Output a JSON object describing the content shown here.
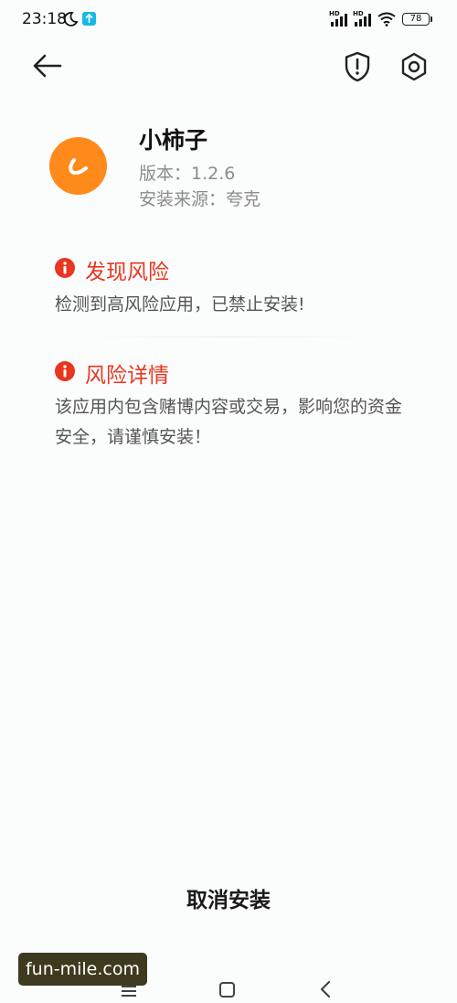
{
  "status_bar": {
    "time": "23:18",
    "hd1": "HD",
    "hd2": "HD",
    "battery": "78",
    "icons": [
      "moon-icon",
      "app-notification-icon",
      "signal-icon",
      "signal-icon",
      "wifi-icon",
      "battery-icon"
    ]
  },
  "nav": {
    "icons": [
      "back-arrow-icon",
      "shield-alert-icon",
      "gear-icon"
    ]
  },
  "app": {
    "name": "小柿子",
    "version": "版本：1.2.6",
    "source": "安装来源：夸克",
    "icon_color": "#ff8a1c"
  },
  "risk_found": {
    "title": "发现风险",
    "text": "检测到高风险应用，已禁止安装!"
  },
  "risk_details": {
    "title": "风险详情",
    "text": "该应用内包含赌博内容或交易，影响您的资金安全，请谨慎安装！"
  },
  "actions": {
    "cancel_install": "取消安装"
  },
  "watermark": "fun-mile.com",
  "colors": {
    "risk_red": "#e9361f",
    "background": "#fbfcfc"
  },
  "system_nav": {
    "icons": [
      "menu-icon",
      "home-icon",
      "back-icon"
    ]
  }
}
